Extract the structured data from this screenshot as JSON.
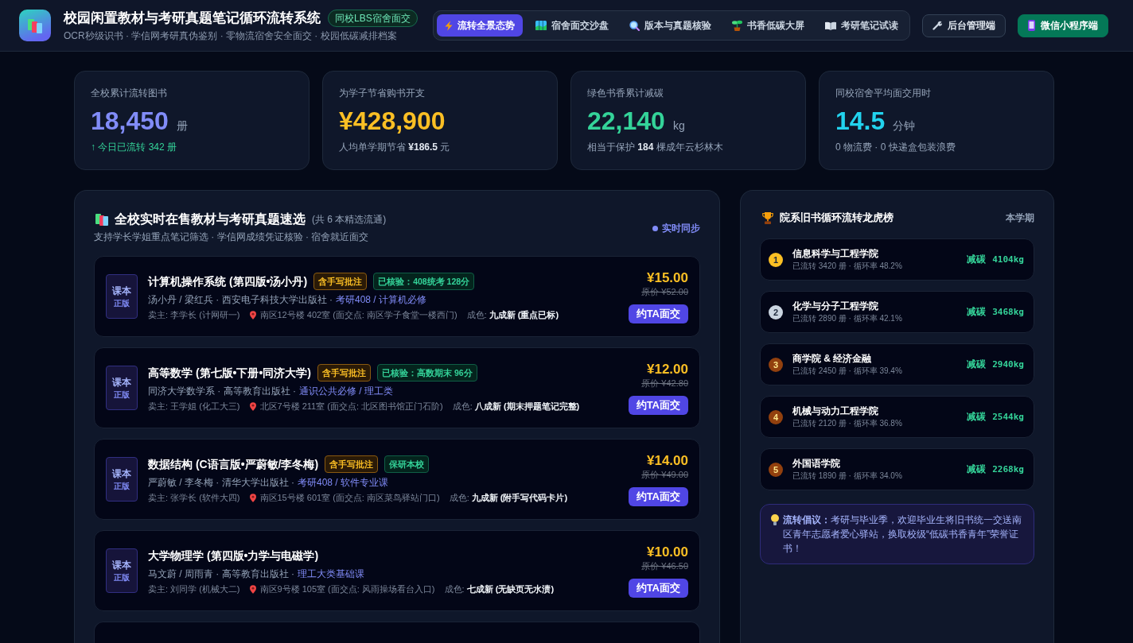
{
  "header": {
    "title": "校园闲置教材与考研真题笔记循环流转系统",
    "badge": "同校LBS宿舍面交",
    "subtitle": "OCR秒级识书 · 学信网考研真伪鉴别 · 零物流宿舍安全面交 · 校园低碳减排档案"
  },
  "nav_tabs": [
    {
      "label": "流转全景态势",
      "selected": true
    },
    {
      "label": "宿舍面交沙盘",
      "selected": false
    },
    {
      "label": "版本与真题核验",
      "selected": false
    },
    {
      "label": "书香低碳大屏",
      "selected": false
    },
    {
      "label": "考研笔记试读",
      "selected": false
    }
  ],
  "header_buttons": [
    {
      "label": "后台管理端",
      "kind": "outline"
    },
    {
      "label": "微信小程序端",
      "kind": "primary"
    }
  ],
  "stats": [
    {
      "label": "全校累计流转图书",
      "value": "18,450",
      "unit": "册",
      "color": "#818cf8",
      "kind": "trend",
      "note": "↑ 今日已流转 342 册"
    },
    {
      "label": "为学子节省购书开支",
      "value": "¥428,900",
      "color": "#fbbf24",
      "kind": "note",
      "note": "人均单学期节省 **¥186.5** 元"
    },
    {
      "label": "绿色书香累计减碳",
      "value": "22,140",
      "unit": "kg",
      "color": "#34d399",
      "kind": "note",
      "note": "相当于保护 **184** 棵成年云杉林木"
    },
    {
      "label": "同校宿舍平均面交用时",
      "value": "14.5",
      "unit": "分钟",
      "color": "#22d3ee",
      "kind": "note",
      "note": "0 物流费 · 0 快递盒包装浪费"
    }
  ],
  "books_panel": {
    "title": "全校实时在售教材与考研真题速选",
    "count": "(共 6 本精选流通)",
    "subtitle": "支持学长学姐重点笔记筛选 · 学信网成绩凭证核验 · 宿舍就近面交",
    "sync": "实时同步",
    "more_below": true,
    "books": [
      {
        "cover_top": "课本",
        "cover_bottom": "正版",
        "title": "计算机操作系统 (第四版•汤小丹)",
        "badges": [
          {
            "kind": "note",
            "text": "含手写批注"
          },
          {
            "kind": "verified",
            "text": "已核验：408统考 128分"
          }
        ],
        "publisher": "汤小丹 / 梁红兵 · 西安电子科技大学出版社 ·",
        "course": "考研408 / 计算机必修",
        "seller": "卖主: 李学长 (计网研一)",
        "location": "南区12号楼 402室 (面交点: 南区学子食堂一楼西门)",
        "condition": "成色: **九成新 (重点已标)**",
        "price": "¥15.00",
        "original_price": "原价 ¥52.00",
        "action": "约TA面交"
      },
      {
        "cover_top": "课本",
        "cover_bottom": "正版",
        "title": "高等数学 (第七版•下册•同济大学)",
        "badges": [
          {
            "kind": "note",
            "text": "含手写批注"
          },
          {
            "kind": "verified",
            "text": "已核验：高数期末 96分"
          }
        ],
        "publisher": "同济大学数学系 · 高等教育出版社 ·",
        "course": "通识公共必修 / 理工类",
        "seller": "卖主: 王学姐 (化工大三)",
        "location": "北区7号楼 211室 (面交点: 北区图书馆正门石阶)",
        "condition": "成色: **八成新 (期末押题笔记完整)**",
        "price": "¥12.00",
        "original_price": "原价 ¥42.80",
        "action": "约TA面交"
      },
      {
        "cover_top": "课本",
        "cover_bottom": "正版",
        "title": "数据结构 (C语言版•严蔚敏/李冬梅)",
        "badges": [
          {
            "kind": "note",
            "text": "含手写批注"
          },
          {
            "kind": "verified",
            "text": "保研本校"
          }
        ],
        "publisher": "严蔚敏 / 李冬梅 · 清华大学出版社 ·",
        "course": "考研408 / 软件专业课",
        "seller": "卖主: 张学长 (软件大四)",
        "location": "南区15号楼 601室 (面交点: 南区菜鸟驿站门口)",
        "condition": "成色: **九成新 (附手写代码卡片)**",
        "price": "¥14.00",
        "original_price": "原价 ¥49.00",
        "action": "约TA面交"
      },
      {
        "cover_top": "课本",
        "cover_bottom": "正版",
        "title": "大学物理学 (第四版•力学与电磁学)",
        "publisher": "马文蔚 / 周雨青 · 高等教育出版社 ·",
        "course": "理工大类基础课",
        "seller": "卖主: 刘同学 (机械大二)",
        "location": "南区9号楼 105室 (面交点: 风雨操场看台入口)",
        "condition": "成色: **七成新 (无缺页无水渍)**",
        "price": "¥10.00",
        "original_price": "原价 ¥46.50",
        "action": "约TA面交"
      }
    ]
  },
  "ranking": {
    "title": "院系旧书循环流转龙虎榜",
    "period": "本学期",
    "items": [
      {
        "rank": "1",
        "color": "#fbbf24",
        "name": "信息科学与工程学院",
        "stats": "已流转 3420 册 · 循环率 48.2%",
        "label": "减碳",
        "value": "4104kg"
      },
      {
        "rank": "2",
        "color": "#cbd5e1",
        "name": "化学与分子工程学院",
        "stats": "已流转 2890 册 · 循环率 42.1%",
        "label": "减碳",
        "value": "3468kg"
      },
      {
        "rank": "3",
        "color": "#92400e",
        "name": "商学院 & 经济金融",
        "stats": "已流转 2450 册 · 循环率 39.4%",
        "label": "减碳",
        "value": "2940kg"
      },
      {
        "rank": "4",
        "color": "#92400e",
        "name": "机械与动力工程学院",
        "stats": "已流转 2120 册 · 循环率 36.8%",
        "label": "减碳",
        "value": "2544kg"
      },
      {
        "rank": "5",
        "color": "#92400e",
        "name": "外国语学院",
        "stats": "已流转 1890 册 · 循环率 34.0%",
        "label": "减碳",
        "value": "2268kg"
      }
    ],
    "tip": "**流转倡议：**考研与毕业季，欢迎毕业生将旧书统一交送南区青年志愿者爱心驿站，换取校级“低碳书香青年”荣誉证书！"
  }
}
